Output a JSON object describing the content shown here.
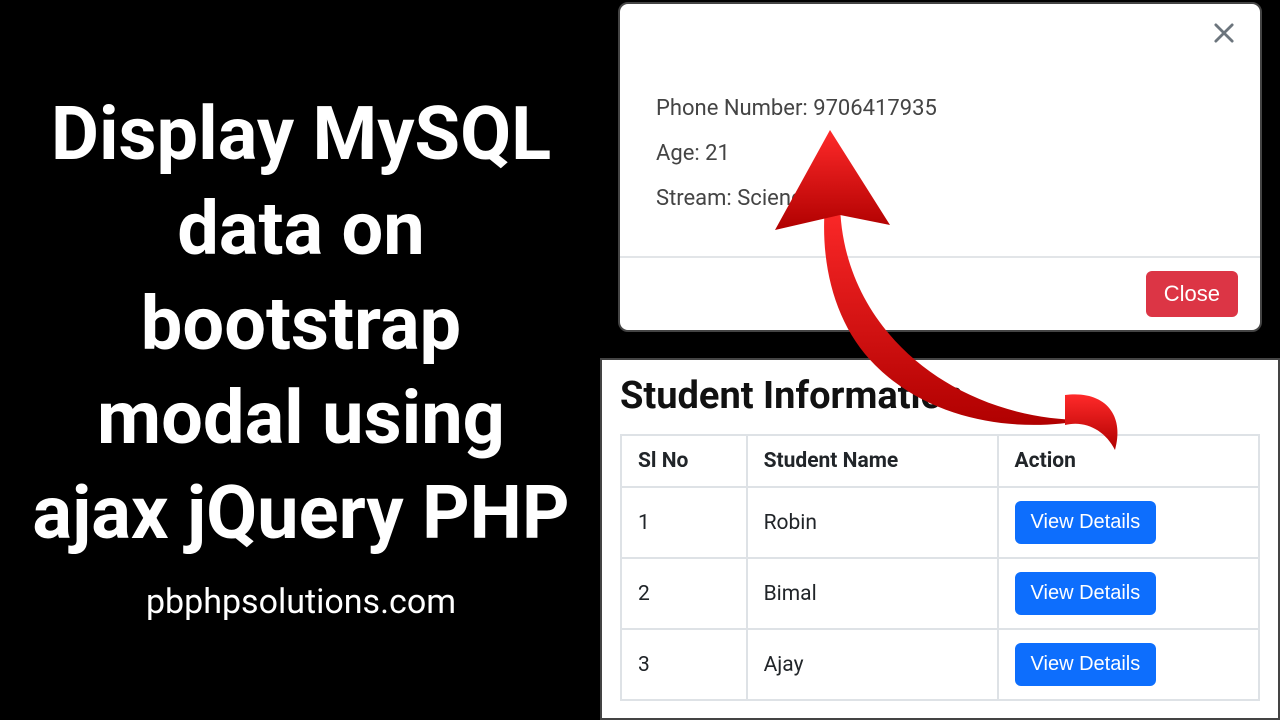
{
  "title": "Display MySQL data on bootstrap modal using ajax jQuery PHP",
  "site_url": "pbphpsolutions.com",
  "modal": {
    "phone_label": "Phone Number:",
    "phone_value": "9706417935",
    "age_label": "Age:",
    "age_value": "21",
    "stream_label": "Stream:",
    "stream_value": "Science",
    "close_label": "Close"
  },
  "table": {
    "heading": "Student Information",
    "columns": [
      "Sl No",
      "Student Name",
      "Action"
    ],
    "action_label": "View Details",
    "rows": [
      {
        "sl": "1",
        "name": "Robin"
      },
      {
        "sl": "2",
        "name": "Bimal"
      },
      {
        "sl": "3",
        "name": "Ajay"
      }
    ]
  }
}
